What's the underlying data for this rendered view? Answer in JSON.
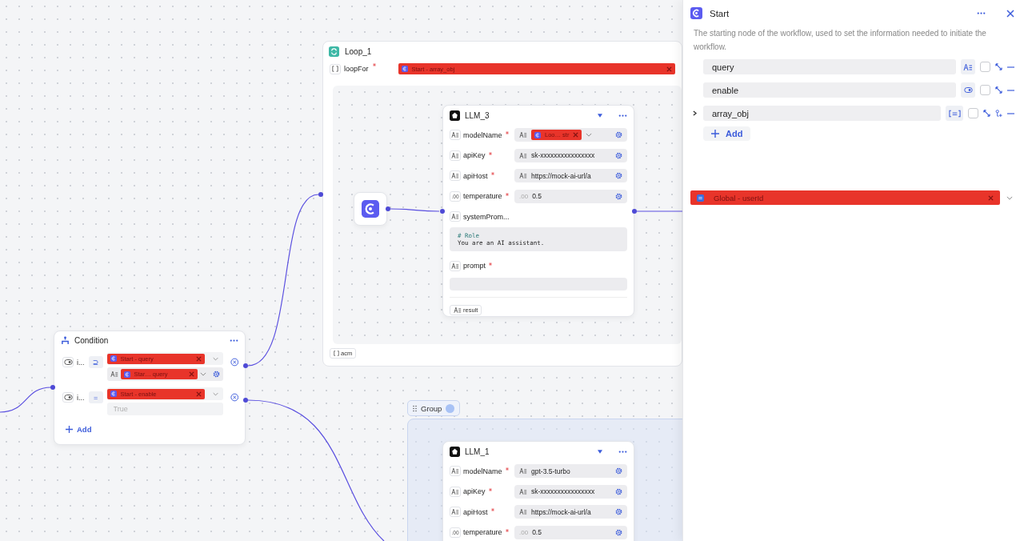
{
  "canvas": {
    "loop": {
      "title": "Loop_1",
      "loop_for": {
        "label": "loopFor",
        "required": true,
        "ref": "Start - array_obj"
      },
      "output": "acm"
    },
    "llm_nodes": [
      {
        "title": "LLM_3",
        "fields": [
          {
            "label": "modelName",
            "required": true,
            "kind": "ref",
            "value": "Loo… str"
          },
          {
            "label": "apiKey",
            "required": true,
            "kind": "value",
            "value": "sk-xxxxxxxxxxxxxxxx"
          },
          {
            "label": "apiHost",
            "required": true,
            "kind": "value",
            "value": "https://mock-ai-url/a"
          },
          {
            "label": "temperature",
            "required": true,
            "type_label": ".00",
            "prefix_label": ".00",
            "kind": "value",
            "value": "0.5"
          },
          {
            "label": "systemProm...",
            "required": false,
            "kind": "textarea",
            "heading": "# Role",
            "value": "You are an AI assistant."
          },
          {
            "label": "prompt",
            "required": true,
            "kind": "textarea"
          }
        ],
        "output": "result"
      },
      {
        "title": "LLM_1",
        "fields": [
          {
            "label": "modelName",
            "required": true,
            "kind": "value",
            "value": "gpt-3.5-turbo"
          },
          {
            "label": "apiKey",
            "required": true,
            "kind": "value",
            "value": "sk-xxxxxxxxxxxxxxxx"
          },
          {
            "label": "apiHost",
            "required": true,
            "kind": "value",
            "value": "https://mock-ai-url/a"
          },
          {
            "label": "temperature",
            "required": true,
            "type_label": ".00",
            "prefix_label": ".00",
            "kind": "value",
            "value": "0.5"
          }
        ]
      }
    ],
    "condition": {
      "title": "Condition",
      "rows": [
        {
          "label": "i...",
          "operator": "⊇",
          "left": "Start - query",
          "right": {
            "kind": "ref",
            "value": "Star… query"
          }
        },
        {
          "label": "i...",
          "operator": "=",
          "left": "Start - enable",
          "right": {
            "kind": "constant",
            "placeholder": "True"
          }
        }
      ],
      "add": "Add"
    },
    "group": {
      "title": "Group"
    }
  },
  "panel": {
    "title": "Start",
    "description": "The starting node of the workflow, used to set the information needed to initiate the workflow.",
    "params": [
      {
        "name": "query",
        "kind": "string",
        "required": false
      },
      {
        "name": "enable",
        "kind": "boolean",
        "required": false
      },
      {
        "name": "array_obj",
        "kind": "array",
        "required": false,
        "expanded": false
      }
    ],
    "add": "Add",
    "global_ref": "Global - userId"
  }
}
